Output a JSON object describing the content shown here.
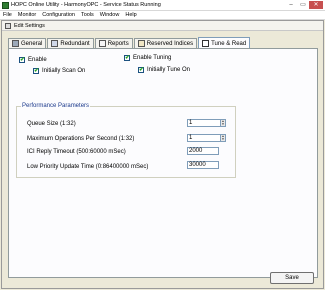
{
  "app": {
    "title": "HOPC Online Utility - HarmonyOPC - Service Status Running",
    "window_controls": {
      "minimize": "–",
      "maximize": "▭",
      "close": "✕"
    }
  },
  "menu": [
    "File",
    "Monitor",
    "Configuration",
    "Tools",
    "Window",
    "Help"
  ],
  "dialog": {
    "title": "Edit Settings"
  },
  "tabs": [
    {
      "label": "General",
      "icon": "wrench-icon"
    },
    {
      "label": "Redundant",
      "icon": "redundant-icon"
    },
    {
      "label": "Reports",
      "icon": "reports-icon"
    },
    {
      "label": "Reserved Indices",
      "icon": "reserved-icon"
    },
    {
      "label": "Tune & Read",
      "icon": "tune-icon",
      "active": true
    }
  ],
  "checkboxes": {
    "enable": {
      "label": "Enable",
      "checked": true
    },
    "initially_scan_on": {
      "label": "Initially Scan On",
      "checked": true
    },
    "enable_tuning": {
      "label": "Enable Tuning",
      "checked": true
    },
    "initially_tune_on": {
      "label": "Initially Tune On",
      "checked": true
    }
  },
  "performance": {
    "legend": "Performance Parameters",
    "queue_size": {
      "label": "Queue Size (1:32)",
      "value": "1"
    },
    "max_ops": {
      "label": "Maximum Operations Per Second (1:32)",
      "value": "1"
    },
    "ici_timeout": {
      "label": "ICI Reply Timeout (500:60000 mSec)",
      "value": "2000"
    },
    "low_priority": {
      "label": "Low Priority Update Time (0:86400000 mSec)",
      "value": "30000"
    }
  },
  "buttons": {
    "save": "Save"
  },
  "check_glyph": "✔",
  "colors": {
    "check": "#21a121",
    "accent": "#1c3a8c"
  }
}
